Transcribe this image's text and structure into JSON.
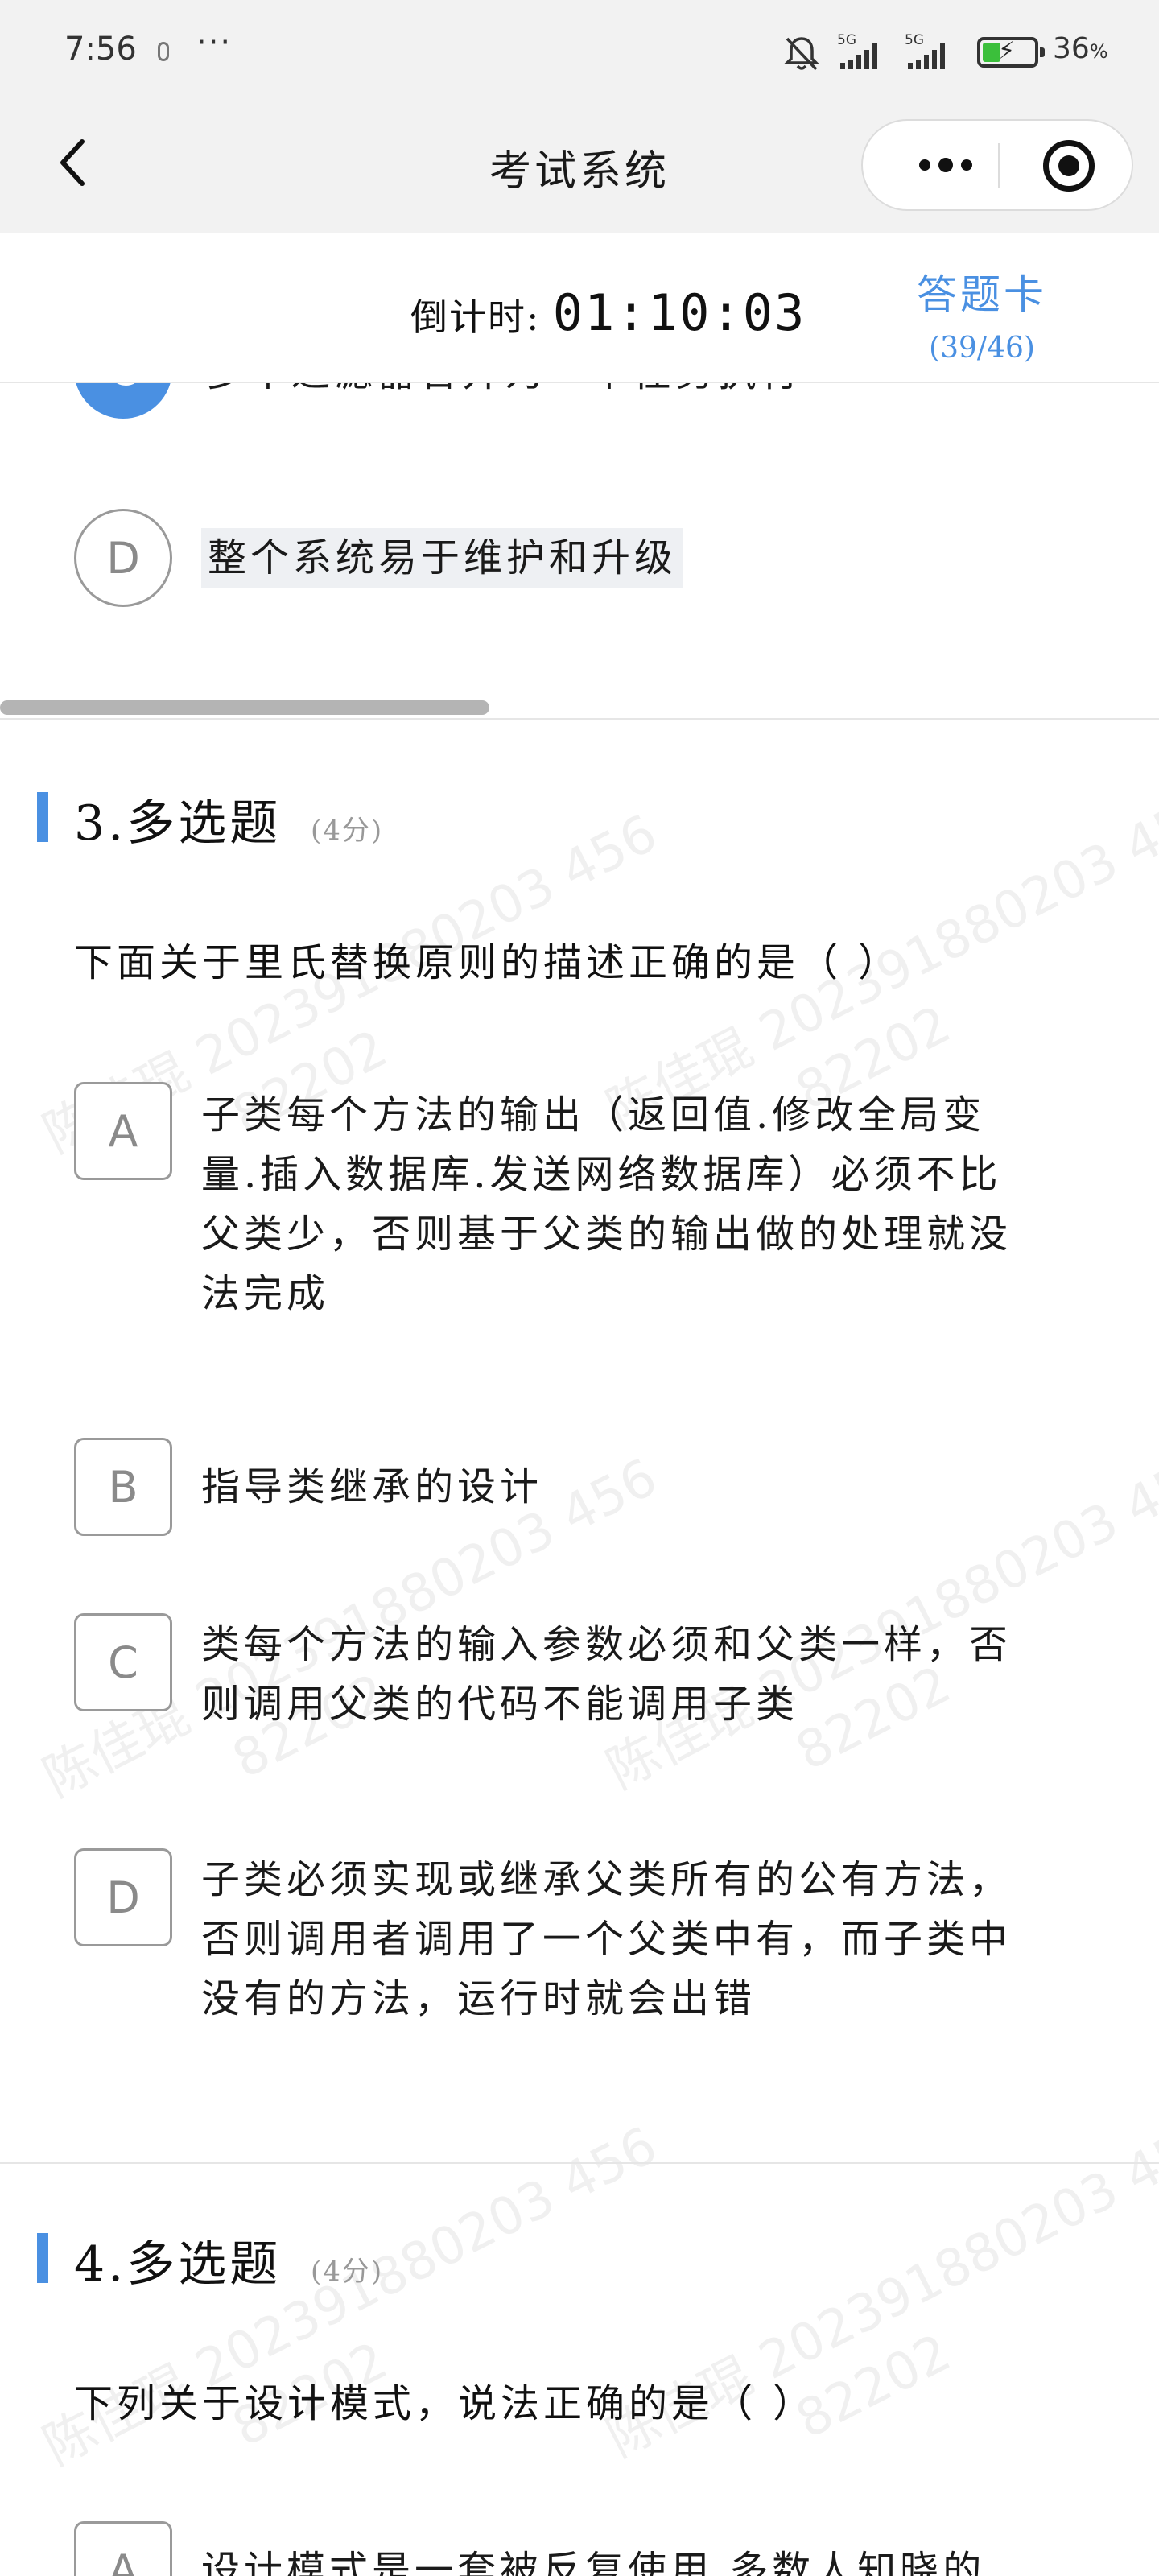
{
  "status_bar": {
    "time": "7:56",
    "dots": "···",
    "signal1_label": "5G",
    "signal2_label": "5G",
    "battery_percent": "36",
    "battery_unit": "%",
    "battery_level": 0.36,
    "battery_color": "#3bbf3b"
  },
  "nav": {
    "title": "考试系统"
  },
  "header": {
    "countdown_label": "倒计时:",
    "countdown_value": "01:10:03",
    "answer_card_label": "答题卡",
    "answer_card_count": "(39/46)",
    "accent_color": "#4a90e2"
  },
  "prev_question": {
    "option_c_letter": "C",
    "option_c_text": "多个过滤器合并为一个任务执行",
    "option_d_letter": "D",
    "option_d_text": "整个系统易于维护和升级"
  },
  "questions": [
    {
      "number_title": "3.多选题",
      "score": "(4分)",
      "stem": "下面关于里氏替换原则的描述正确的是（ ）",
      "options": [
        {
          "letter": "A",
          "lines": [
            "子类每个方法的输出（返回值.修改全局变",
            "量.插入数据库.发送网络数据库）必须不比",
            "父类少，否则基于父类的输出做的处理就没",
            "法完成"
          ]
        },
        {
          "letter": "B",
          "lines": [
            "指导类继承的设计"
          ]
        },
        {
          "letter": "C",
          "lines": [
            "类每个方法的输入参数必须和父类一样，否",
            "则调用父类的代码不能调用子类"
          ]
        },
        {
          "letter": "D",
          "lines": [
            "子类必须实现或继承父类所有的公有方法，",
            "否则调用者调用了一个父类中有，而子类中",
            "没有的方法，运行时就会出错"
          ]
        }
      ]
    },
    {
      "number_title": "4.多选题",
      "score": "(4分)",
      "stem": "下列关于设计模式，说法正确的是（ ）",
      "options": [
        {
          "letter": "A",
          "lines": [
            "设计模式是一套被反复使用,多数人知晓的"
          ]
        }
      ]
    }
  ],
  "watermark": {
    "line1": "陈佳琨 202391880203 456",
    "line2": "82202"
  }
}
